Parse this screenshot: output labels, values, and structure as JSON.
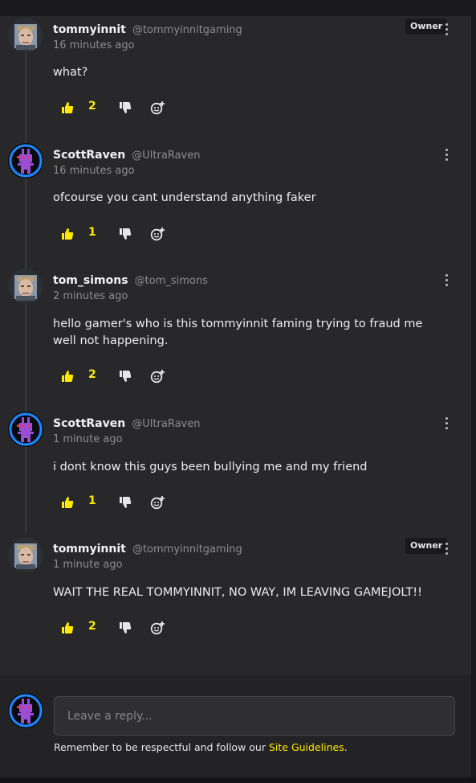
{
  "comments": [
    {
      "author": "tommyinnit",
      "handle": "@tommyinnitgaming",
      "time": "16 minutes ago",
      "badge": "Owner",
      "text": "what?",
      "likes": "2",
      "avatar_icon": "face-photo-icon"
    },
    {
      "author": "ScottRaven",
      "handle": "@UltraRaven",
      "time": "16 minutes ago",
      "badge": "",
      "text": "ofcourse you cant understand anything faker",
      "likes": "1",
      "avatar_icon": "purple-bunny-icon"
    },
    {
      "author": "tom_simons",
      "handle": "@tom_simons",
      "time": "2 minutes ago",
      "badge": "",
      "text": "hello gamer's who is this tommyinnit faming trying to fraud me well not happening.",
      "likes": "2",
      "avatar_icon": "face-photo-icon"
    },
    {
      "author": "ScottRaven",
      "handle": "@UltraRaven",
      "time": "1 minute ago",
      "badge": "",
      "text": "i dont know this guys been bullying me and my friend",
      "likes": "1",
      "avatar_icon": "purple-bunny-icon"
    },
    {
      "author": "tommyinnit",
      "handle": "@tommyinnitgaming",
      "time": "1 minute ago",
      "badge": "Owner",
      "text": "WAIT THE REAL TOMMYINNIT, NO WAY, IM LEAVING GAMEJOLT!!",
      "likes": "2",
      "avatar_icon": "face-photo-icon"
    }
  ],
  "reply": {
    "placeholder": "Leave a reply...",
    "guidelines_prefix": "Remember to be respectful and follow our ",
    "guidelines_link": "Site Guidelines",
    "guidelines_suffix": "."
  },
  "colors": {
    "accent": "#ffea00",
    "panel": "#28282b",
    "background": "#1f1f22",
    "avatar_ring": "#1e88ff",
    "bunny": "#9b4dd6"
  }
}
